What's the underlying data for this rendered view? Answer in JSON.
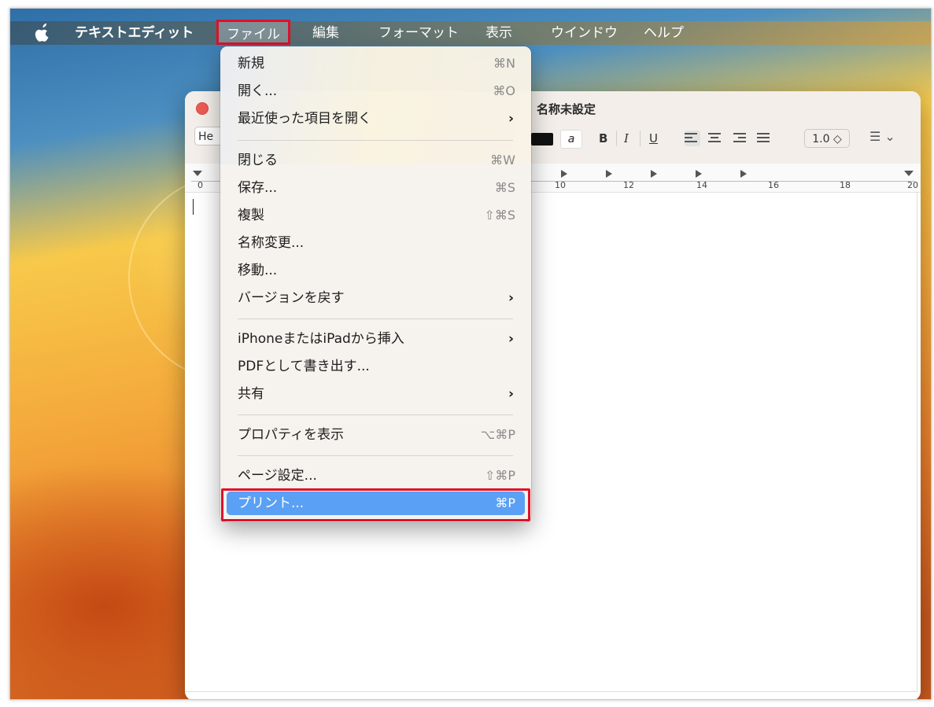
{
  "menubar": {
    "app_name": "テキストエディット",
    "items": [
      "ファイル",
      "編集",
      "フォーマット",
      "表示",
      "ウインドウ",
      "ヘルプ"
    ]
  },
  "window": {
    "title": "名称未設定",
    "font_button": "He",
    "bold": "B",
    "italic": "I",
    "underline": "U",
    "line_spacing": "1.0 ◇",
    "list_icon": "☰ ⌄",
    "highlight_glyph": "a",
    "ruler_numbers": [
      "0",
      "10",
      "12",
      "14",
      "16",
      "18",
      "20"
    ]
  },
  "file_menu": {
    "new": {
      "label": "新規",
      "shortcut": "⌘N"
    },
    "open": {
      "label": "開く...",
      "shortcut": "⌘O"
    },
    "open_recent": {
      "label": "最近使った項目を開く"
    },
    "close": {
      "label": "閉じる",
      "shortcut": "⌘W"
    },
    "save": {
      "label": "保存...",
      "shortcut": "⌘S"
    },
    "duplicate": {
      "label": "複製",
      "shortcut": "⇧⌘S"
    },
    "rename": {
      "label": "名称変更..."
    },
    "move": {
      "label": "移動..."
    },
    "revert": {
      "label": "バージョンを戻す"
    },
    "insert_from_iphone": {
      "label": "iPhoneまたはiPadから挿入"
    },
    "export_pdf": {
      "label": "PDFとして書き出す..."
    },
    "share": {
      "label": "共有"
    },
    "properties": {
      "label": "プロパティを表示",
      "shortcut": "⌥⌘P"
    },
    "page_setup": {
      "label": "ページ設定...",
      "shortcut": "⇧⌘P"
    },
    "print": {
      "label": "プリント...",
      "shortcut": "⌘P"
    }
  },
  "colors": {
    "highlight_border": "#e0102a",
    "selected_item": "#5aa0f4"
  }
}
